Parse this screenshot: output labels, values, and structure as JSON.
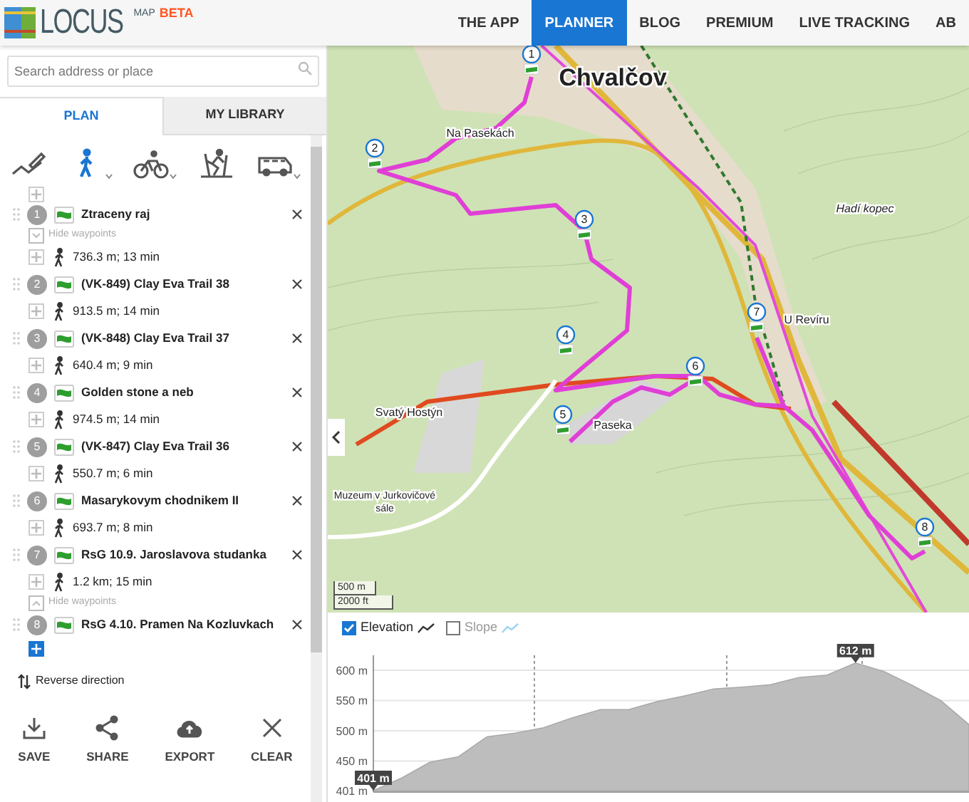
{
  "logo": {
    "name": "LOCUS",
    "sup": "MAP",
    "badge": "BETA"
  },
  "nav": [
    {
      "label": "THE APP",
      "selected": false
    },
    {
      "label": "PLANNER",
      "selected": true
    },
    {
      "label": "BLOG",
      "selected": false
    },
    {
      "label": "PREMIUM",
      "selected": false
    },
    {
      "label": "LIVE TRACKING",
      "selected": false
    },
    {
      "label": "AB",
      "selected": false
    }
  ],
  "search": {
    "placeholder": "Search address or place"
  },
  "tabs": [
    {
      "label": "PLAN",
      "selected": true
    },
    {
      "label": "MY LIBRARY",
      "selected": false
    }
  ],
  "modes": [
    {
      "kind": "draw",
      "selected": false,
      "caret": false
    },
    {
      "kind": "hike",
      "selected": true,
      "caret": true
    },
    {
      "kind": "bike",
      "selected": false,
      "caret": true
    },
    {
      "kind": "ski",
      "selected": false,
      "caret": false
    },
    {
      "kind": "car",
      "selected": false,
      "caret": true
    }
  ],
  "route": [
    {
      "kind": "waypoint",
      "number": "1",
      "name": "Ztraceny raj"
    },
    {
      "kind": "toggle",
      "label": "Hide waypoints",
      "expanded": true
    },
    {
      "kind": "segment",
      "text": "736.3 m; 13 min"
    },
    {
      "kind": "waypoint",
      "number": "2",
      "name": "(VK-849) Clay Eva Trail 38"
    },
    {
      "kind": "segment",
      "text": "913.5 m; 14 min"
    },
    {
      "kind": "waypoint",
      "number": "3",
      "name": "(VK-848) Clay Eva Trail 37"
    },
    {
      "kind": "segment",
      "text": "640.4 m; 9 min"
    },
    {
      "kind": "waypoint",
      "number": "4",
      "name": "Golden stone a neb"
    },
    {
      "kind": "segment",
      "text": "974.5 m; 14 min"
    },
    {
      "kind": "waypoint",
      "number": "5",
      "name": "(VK-847) Clay Eva Trail 36"
    },
    {
      "kind": "segment",
      "text": "550.7 m; 6 min"
    },
    {
      "kind": "waypoint",
      "number": "6",
      "name": "Masarykovym chodnikem II"
    },
    {
      "kind": "segment",
      "text": "693.7 m; 8 min"
    },
    {
      "kind": "waypoint",
      "number": "7",
      "name": "RsG 10.9. Jaroslavova studanka"
    },
    {
      "kind": "segment",
      "text": "1.2 km; 15 min"
    },
    {
      "kind": "toggle",
      "label": "Hide waypoints",
      "expanded": false
    },
    {
      "kind": "waypoint",
      "number": "8",
      "name": "RsG 4.10. Pramen Na Kozluvkach"
    }
  ],
  "reverse": "Reverse direction",
  "actions": [
    {
      "kind": "save",
      "label": "SAVE"
    },
    {
      "kind": "share",
      "label": "SHARE"
    },
    {
      "kind": "export",
      "label": "EXPORT"
    },
    {
      "kind": "clear",
      "label": "CLEAR"
    }
  ],
  "map": {
    "labels": [
      {
        "text": "Chvalčov",
        "kind": "town"
      },
      {
        "text": "Na Pasekách",
        "kind": "place"
      },
      {
        "text": "Hadí kopec",
        "kind": "peak"
      },
      {
        "text": "U Revíru",
        "kind": "place"
      },
      {
        "text": "Svatý Hostýn",
        "kind": "place"
      },
      {
        "text": "Paseka",
        "kind": "place"
      },
      {
        "text": "Muzeum v Jurkovičové",
        "kind": "poi"
      },
      {
        "text": "sále",
        "kind": "poi"
      }
    ],
    "markers": [
      "1",
      "2",
      "3",
      "4",
      "5",
      "6",
      "7",
      "8"
    ],
    "scale": [
      "500 m",
      "2000 ft"
    ]
  },
  "profile": {
    "toggles": [
      {
        "checked": true
      },
      {
        "label": "Slope",
        "checked": false
      }
    ],
    "peaks": [
      "612 m",
      "401 m"
    ],
    "chart_data": {
      "type": "area",
      "categories": [
        null,
        null,
        null,
        null,
        null,
        null,
        null,
        null,
        null,
        null,
        null,
        null,
        null,
        null,
        null,
        null,
        null,
        null,
        null,
        null,
        null,
        null
      ],
      "series": [
        {
          "name": "Elevation",
          "color": "#bdbdbd",
          "values": [
            401,
            422,
            448,
            457,
            490,
            496,
            505,
            521,
            535,
            535,
            548,
            558,
            569,
            572,
            576,
            588,
            592,
            612,
            598,
            575,
            550,
            510
          ]
        }
      ],
      "ylim": [
        401,
        620
      ],
      "grid": true,
      "yticks": [
        {
          "value": 401,
          "label": "401 m"
        },
        {
          "value": 450,
          "label": "450 m"
        },
        {
          "value": 500,
          "label": "500 m"
        },
        {
          "value": 550,
          "label": "550 m"
        },
        {
          "value": 600,
          "label": "600 m"
        }
      ]
    }
  }
}
